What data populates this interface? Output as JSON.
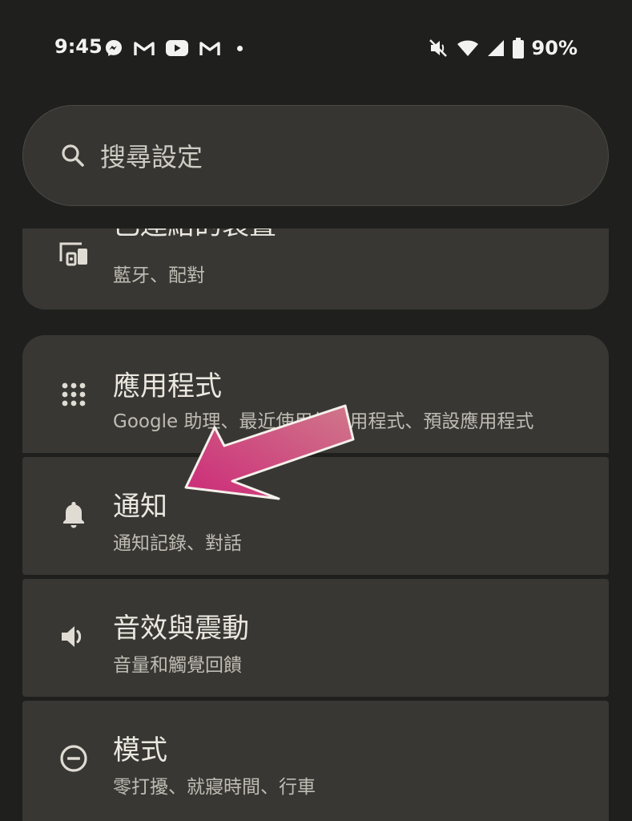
{
  "status_bar": {
    "time": "9:45",
    "left_icons": [
      "messenger-icon",
      "gmail-icon",
      "youtube-icon",
      "gmail-icon",
      "dot-indicator"
    ],
    "right_icons": [
      "mute-icon",
      "wifi-icon",
      "cell-signal-icon",
      "battery-icon"
    ],
    "battery": "90%"
  },
  "search": {
    "placeholder": "搜尋設定"
  },
  "settings": {
    "connected_devices": {
      "title": "已連結的裝置",
      "subtitle": "藍牙、配對",
      "icon": "devices-icon"
    },
    "apps": {
      "title": "應用程式",
      "subtitle": "Google 助理、最近使用的應用程式、預設應用程式",
      "icon": "apps-grid-icon"
    },
    "notifications": {
      "title": "通知",
      "subtitle": "通知記錄、對話",
      "icon": "bell-icon"
    },
    "sound": {
      "title": "音效與震動",
      "subtitle": "音量和觸覺回饋",
      "icon": "speaker-icon"
    },
    "modes": {
      "title": "模式",
      "subtitle": "零打擾、就寢時間、行車",
      "icon": "do-not-disturb-icon"
    }
  },
  "colors": {
    "background": "#1f201d",
    "card": "#383734",
    "arrow": "#cc2f7a"
  }
}
